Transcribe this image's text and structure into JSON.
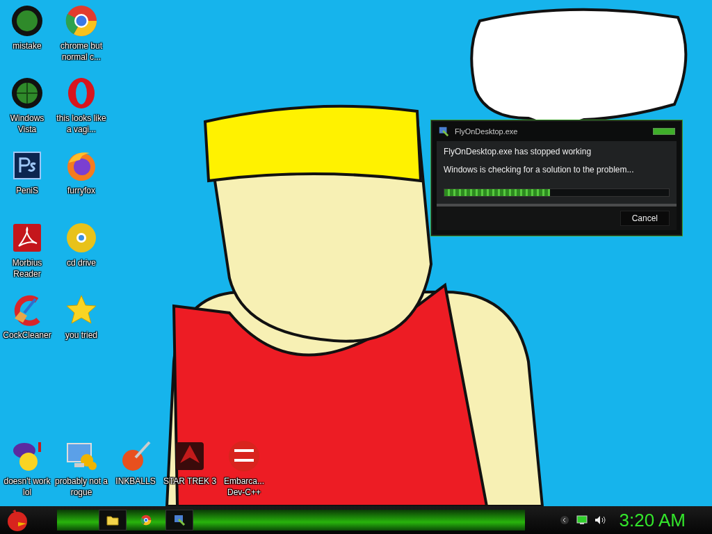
{
  "desktop": {
    "icons_left": [
      {
        "label": "mistake"
      },
      {
        "label": "chrome but normal c..."
      },
      {
        "label": "Windows Vista"
      },
      {
        "label": "this looks like a vagi..."
      },
      {
        "label": "PeniS"
      },
      {
        "label": "furryfox"
      },
      {
        "label": "Morbius Reader"
      },
      {
        "label": "cd drive"
      },
      {
        "label": "CockCleaner"
      },
      {
        "label": "you tried"
      }
    ],
    "icons_bottom": [
      {
        "label": "doesn't work lol"
      },
      {
        "label": "probably not a rogue"
      },
      {
        "label": "INKBALLS"
      },
      {
        "label": "STAR TREK 3"
      },
      {
        "label": "Embarca... Dev-C++"
      }
    ]
  },
  "dialog": {
    "title": "FlyOnDesktop.exe",
    "heading": "FlyOnDesktop.exe has stopped working",
    "message": "Windows is checking for a solution to the problem...",
    "progress": {
      "level": 0.47
    },
    "buttons": [
      "Cancel"
    ]
  },
  "taskbar": {
    "items": [
      {
        "open": true
      },
      {
        "open": false
      },
      {
        "open": true
      }
    ],
    "clock": "3:20 AM"
  }
}
